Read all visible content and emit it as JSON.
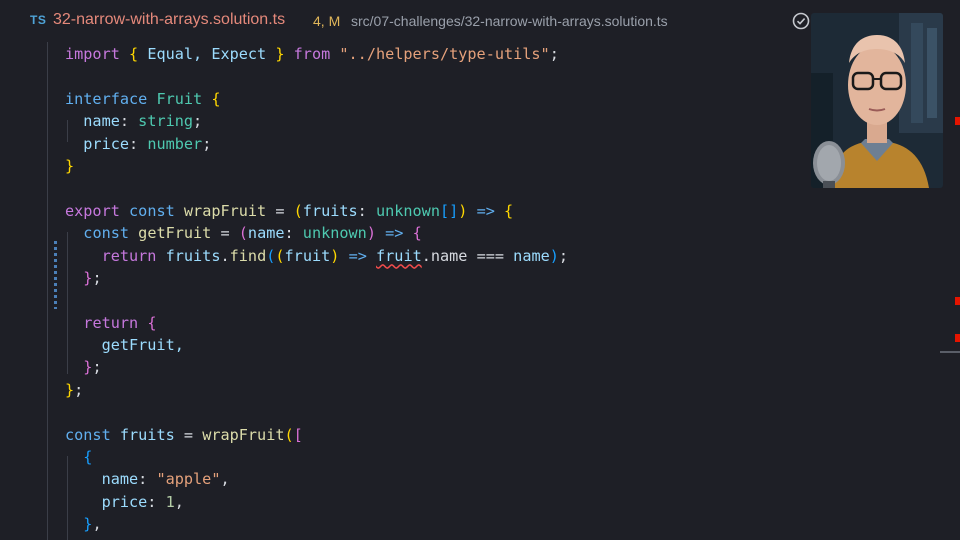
{
  "tab": {
    "lang_badge": "TS",
    "filename": "32-narrow-with-arrays.solution.ts",
    "status": "4, M",
    "path": "src/07-challenges/32-narrow-with-arrays.solution.ts"
  },
  "toolbar_icons": [
    "check-circle-icon",
    "source-control-icon",
    "more-icon"
  ],
  "code": {
    "l1": {
      "a": "import",
      "b": " ",
      "c": "{",
      "d": " Equal, Expect ",
      "e": "}",
      "f": " ",
      "g": "from",
      "h": " ",
      "i": "\"../helpers/type-utils\"",
      "j": ";"
    },
    "l3": {
      "a": "interface",
      "b": " ",
      "c": "Fruit",
      "d": " ",
      "e": "{"
    },
    "l4": {
      "a": "  name",
      "b": ": ",
      "c": "string",
      "d": ";"
    },
    "l5": {
      "a": "  price",
      "b": ": ",
      "c": "number",
      "d": ";"
    },
    "l6": {
      "a": "}"
    },
    "l8": {
      "a": "export",
      "b": " ",
      "c": "const",
      "d": " ",
      "e": "wrapFruit",
      "f": " = ",
      "g": "(",
      "h": "fruits",
      "i": ": ",
      "j": "unknown",
      "k": "[]",
      "l": ")",
      "m": " ",
      "n": "=>",
      "o": " ",
      "p": "{"
    },
    "l9": {
      "a": "  ",
      "b": "const",
      "c": " ",
      "d": "getFruit",
      "e": " = ",
      "f": "(",
      "g": "name",
      "h": ": ",
      "i": "unknown",
      "j": ")",
      "k": " ",
      "l": "=>",
      "m": " ",
      "n": "{"
    },
    "l10": {
      "a": "    ",
      "b": "return",
      "c": " ",
      "d": "fruits",
      "e": ".",
      "f": "find",
      "g": "(",
      "h": "(",
      "i": "fruit",
      "j": ")",
      "k": " ",
      "l": "=>",
      "m": " ",
      "n": "fruit",
      "o": ".name === ",
      "p": "name",
      "q": ")",
      "r": ";"
    },
    "l11": {
      "a": "  ",
      "b": "}",
      "c": ";"
    },
    "l13": {
      "a": "  ",
      "b": "return",
      "c": " ",
      "d": "{"
    },
    "l14": {
      "a": "    getFruit,"
    },
    "l15": {
      "a": "  ",
      "b": "}",
      "c": ";"
    },
    "l16": {
      "a": "}",
      "b": ";"
    },
    "l18": {
      "a": "const",
      "b": " ",
      "c": "fruits",
      "d": " = ",
      "e": "wrapFruit",
      "f": "(",
      "g": "["
    },
    "l19": {
      "a": "  ",
      "b": "{"
    },
    "l20": {
      "a": "    name",
      "b": ": ",
      "c": "\"apple\"",
      "d": ","
    },
    "l21": {
      "a": "    price",
      "b": ": ",
      "c": "1",
      "d": ","
    },
    "l22": {
      "a": "  ",
      "b": "}",
      "c": ","
    }
  },
  "colors": {
    "background": "#1e1f26",
    "filename": "#e5897b",
    "modified_badge": "#e0b65a",
    "keyword": "#c678dd",
    "type": "#4ec9b0",
    "string": "#e5a17b",
    "error": "#f14c4c"
  }
}
